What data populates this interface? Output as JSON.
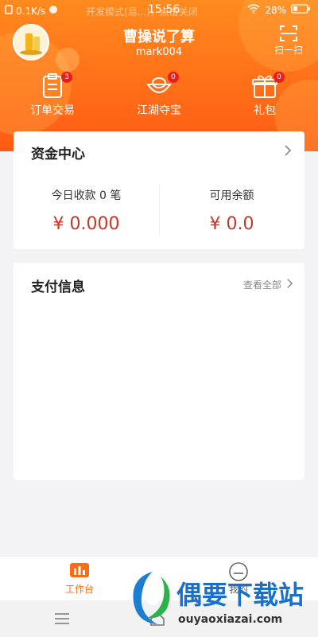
{
  "status_bar": {
    "network_speed": "0.1K/s",
    "dev_mode_notice": "开发模式(易...)，点击关闭",
    "time": "15:56",
    "battery": "28%"
  },
  "header": {
    "shop_name": "曹操说了算",
    "account": "mark004",
    "scan_label": "扫一扫"
  },
  "quick_actions": [
    {
      "label": "订单交易",
      "badge": "3",
      "icon": "clipboard-icon"
    },
    {
      "label": "江湖夺宝",
      "badge": "0",
      "icon": "treasure-icon"
    },
    {
      "label": "礼包",
      "badge": "0",
      "icon": "gift-icon"
    }
  ],
  "fund_card": {
    "title": "资金中心",
    "today_label": "今日收款 0 笔",
    "today_value": "¥ 0.000",
    "balance_label": "可用余额",
    "balance_value": "¥ 0.0"
  },
  "payment_card": {
    "title": "支付信息",
    "view_all": "查看全部"
  },
  "tabbar": {
    "workbench": "工作台",
    "mine": "我的"
  },
  "watermark": {
    "title": "偶要下载站",
    "url": "ouyaoxiazai.com"
  },
  "colors": {
    "brand_orange": "#ff6a14",
    "amount_red": "#c0392b",
    "badge_red": "#e81d1d"
  }
}
